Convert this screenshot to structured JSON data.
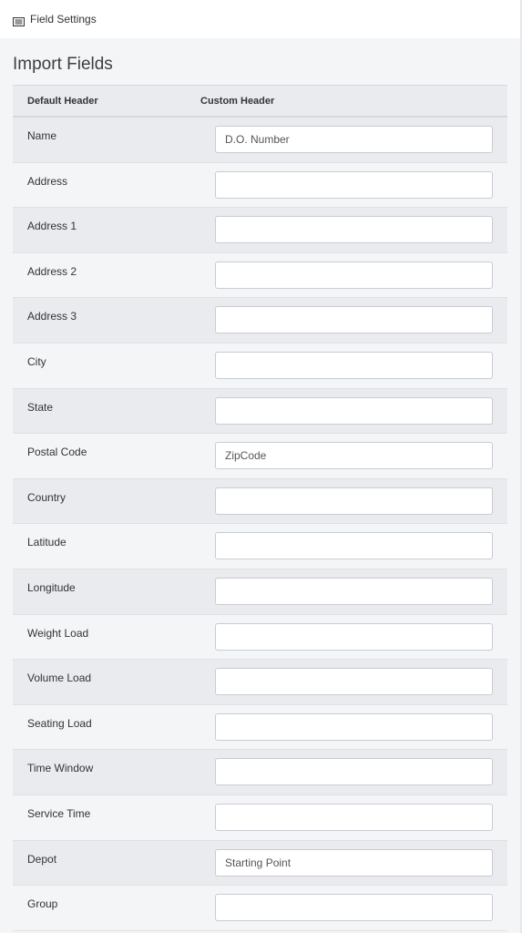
{
  "topbar": {
    "title": "Field Settings",
    "icon": "list-icon"
  },
  "section": {
    "title": "Import Fields"
  },
  "table": {
    "headers": [
      "Default Header",
      "Custom Header"
    ],
    "rows": [
      {
        "label": "Name",
        "value": "D.O. Number"
      },
      {
        "label": "Address",
        "value": ""
      },
      {
        "label": "Address 1",
        "value": ""
      },
      {
        "label": "Address 2",
        "value": ""
      },
      {
        "label": "Address 3",
        "value": ""
      },
      {
        "label": "City",
        "value": ""
      },
      {
        "label": "State",
        "value": ""
      },
      {
        "label": "Postal Code",
        "value": "ZipCode"
      },
      {
        "label": "Country",
        "value": ""
      },
      {
        "label": "Latitude",
        "value": ""
      },
      {
        "label": "Longitude",
        "value": ""
      },
      {
        "label": "Weight Load",
        "value": ""
      },
      {
        "label": "Volume Load",
        "value": ""
      },
      {
        "label": "Seating Load",
        "value": ""
      },
      {
        "label": "Time Window",
        "value": ""
      },
      {
        "label": "Service Time",
        "value": ""
      },
      {
        "label": "Depot",
        "value": "Starting Point"
      },
      {
        "label": "Group",
        "value": ""
      }
    ]
  }
}
